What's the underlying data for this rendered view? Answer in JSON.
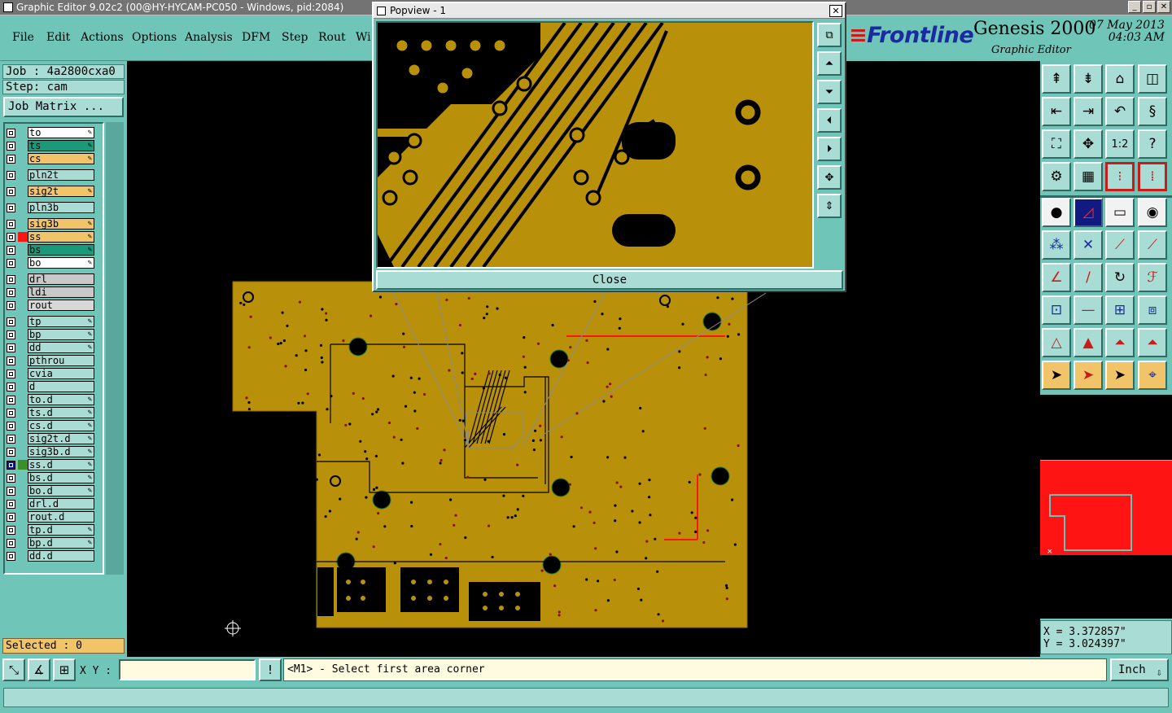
{
  "window": {
    "title": "Graphic Editor 9.02c2 (00@HY-HYCAM-PC050 - Windows, pid:2084)"
  },
  "menu": [
    "File",
    "Edit",
    "Actions",
    "Options",
    "Analysis",
    "DFM",
    "Step",
    "Rout",
    "Wi"
  ],
  "brand": {
    "name": "Frontline",
    "product": "Genesis 2000",
    "subtitle": "Graphic Editor",
    "date": "07 May 2013",
    "time": "04:03 AM"
  },
  "job": {
    "job": "Job : 4a2800cxa0",
    "step": "Step: cam",
    "matrix_button": "Job Matrix ..."
  },
  "layers": [
    {
      "name": "to",
      "color": "#ffffff",
      "pen": true
    },
    {
      "name": "ts",
      "color": "#1a9a7a",
      "pen": true
    },
    {
      "name": "cs",
      "color": "#f2c46a",
      "pen": true
    },
    {
      "name": "pln2t",
      "color": "#a8dcd4",
      "pen": false
    },
    {
      "name": "sig2t",
      "color": "#f2c46a",
      "pen": true
    },
    {
      "name": "pln3b",
      "color": "#a8dcd4",
      "pen": false
    },
    {
      "name": "sig3b",
      "color": "#f2c46a",
      "pen": true
    },
    {
      "name": "ss",
      "color": "#f2c46a",
      "pen": true,
      "marker": "#ff1414"
    },
    {
      "name": "bs",
      "color": "#1a9a7a",
      "pen": true
    },
    {
      "name": "bo",
      "color": "#ffffff",
      "pen": true
    },
    {
      "name": "drl",
      "color": "#c8c8c8",
      "pen": false
    },
    {
      "name": "ldi",
      "color": "#c8c8c8",
      "pen": false
    },
    {
      "name": "rout",
      "color": "#d8d8d8",
      "pen": false
    },
    {
      "name": "tp",
      "color": "#a8dcd4",
      "pen": true
    },
    {
      "name": "bp",
      "color": "#a8dcd4",
      "pen": true
    },
    {
      "name": "dd",
      "color": "#a8dcd4",
      "pen": true
    },
    {
      "name": "pthrou",
      "color": "#a8dcd4",
      "pen": false
    },
    {
      "name": "cvia",
      "color": "#a8dcd4",
      "pen": false
    },
    {
      "name": "d",
      "color": "#a8dcd4",
      "pen": false
    },
    {
      "name": "to.d",
      "color": "#a8dcd4",
      "pen": true
    },
    {
      "name": "ts.d",
      "color": "#a8dcd4",
      "pen": true
    },
    {
      "name": "cs.d",
      "color": "#a8dcd4",
      "pen": true
    },
    {
      "name": "sig2t.d",
      "color": "#a8dcd4",
      "pen": true
    },
    {
      "name": "sig3b.d",
      "color": "#a8dcd4",
      "pen": true
    },
    {
      "name": "ss.d",
      "color": "#a8dcd4",
      "pen": true,
      "marker": "#3a8f2a",
      "selected": true
    },
    {
      "name": "bs.d",
      "color": "#a8dcd4",
      "pen": true
    },
    {
      "name": "bo.d",
      "color": "#a8dcd4",
      "pen": true
    },
    {
      "name": "drl.d",
      "color": "#a8dcd4",
      "pen": false
    },
    {
      "name": "rout.d",
      "color": "#a8dcd4",
      "pen": false
    },
    {
      "name": "tp.d",
      "color": "#a8dcd4",
      "pen": true
    },
    {
      "name": "bp.d",
      "color": "#a8dcd4",
      "pen": true
    },
    {
      "name": "dd.d",
      "color": "#a8dcd4",
      "pen": false
    }
  ],
  "selected": "Selected : 0",
  "popup": {
    "title": "Popview - 1",
    "close_label": "Close"
  },
  "coords": {
    "x": "X = 3.372857\"",
    "y": "Y = 3.024397\""
  },
  "command": {
    "xy_label": "X Y :",
    "xy_value": "",
    "message": "<M1> - Select first area corner",
    "unit": "Inch"
  },
  "toolbar": {
    "ratio_label": "1:2"
  },
  "colors": {
    "panel": "#6fc6b8",
    "board": "#b8900a",
    "accent_red": "#ff1414"
  }
}
